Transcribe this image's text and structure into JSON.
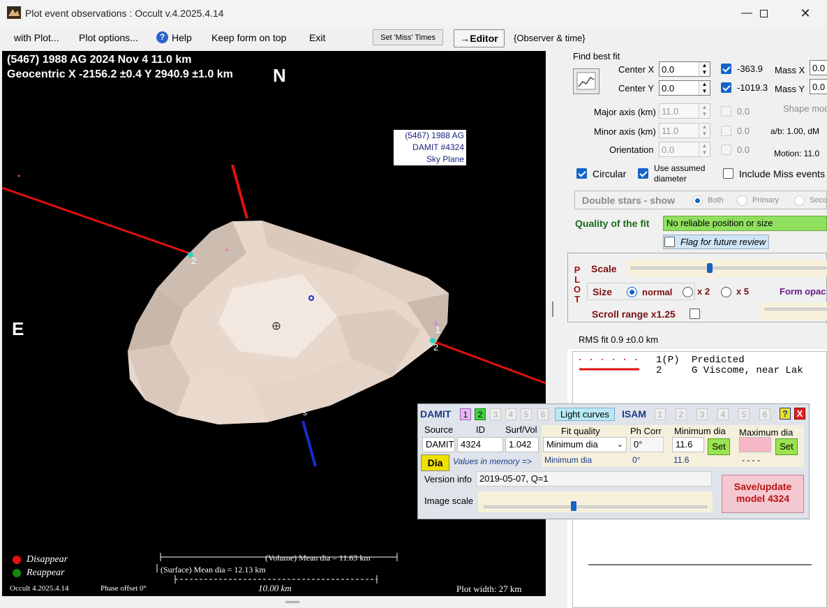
{
  "window": {
    "title": "Plot event observations : Occult v.4.2025.4.14"
  },
  "menu": {
    "with_plot": "with Plot...",
    "plot_options": "Plot options...",
    "help": "Help",
    "keep_on_top": "Keep form on top",
    "exit": "Exit",
    "set_miss_times": "Set 'Miss' Times",
    "editor": "→Editor",
    "observer_time": "{Observer & time}"
  },
  "plot": {
    "header_line1": "(5467) 1988 AG  2024 Nov 4   11.0 km",
    "header_line2": "Geocentric  X  -2156.2 ±0.4  Y 2940.9 ±1.0 km",
    "north": "N",
    "east": "E",
    "info_line1": "(5467) 1988 AG",
    "info_line2": "DAMIT #4324",
    "info_line3": "Sky Plane",
    "chord_label_1": "1",
    "chord_label_2a": "2",
    "chord_label_2b": "2",
    "south_mark": "s",
    "legend_disappear": "Disappear",
    "legend_reappear": "Reappear",
    "volume_mean": "(Volume) Mean dia = 11.63 km",
    "surface_mean": "(Surface) Mean dia = 12.13 km",
    "scale_bar": "10.00 km",
    "version": "Occult 4.2025.4.14",
    "phase_offset": "Phase offset 0°",
    "plot_width": "Plot width: 27 km"
  },
  "fit": {
    "heading": "Find best fit",
    "center_x_label": "Center X",
    "center_x": "0.0",
    "center_y_label": "Center Y",
    "center_y": "0.0",
    "x_val": "-363.9",
    "y_val": "-1019.3",
    "mass_x_label": "Mass X",
    "mass_x": "0.0",
    "mass_y_label": "Mass Y",
    "mass_y": "0.0",
    "major_label": "Major axis (km)",
    "major": "11.0",
    "minor_label": "Minor axis (km)",
    "minor": "11.0",
    "orient_label": "Orientation",
    "orient": "0.0",
    "major_chk": "0.0",
    "minor_chk": "0.0",
    "orient_chk": "0.0",
    "shape_model": "Shape mod",
    "ab": "a/b: 1.00, dM",
    "motion": "Motion: 11.0",
    "circular": "Circular",
    "use_assumed_1": "Use assumed",
    "use_assumed_2": "diameter",
    "include_miss": "Include Miss events",
    "double_stars": "Double stars - show",
    "both": "Both",
    "primary": "Primary",
    "secondary": "Seco",
    "quality_label": "Quality of the fit",
    "quality_value": "No reliable position or size",
    "flag_review": "Flag for future review"
  },
  "plot_ctrl": {
    "side_label": [
      "P",
      "L",
      "O",
      "T"
    ],
    "scale": "Scale",
    "size": "Size",
    "normal": "normal",
    "x2": "x 2",
    "x5": "x 5",
    "form_opacity": "Form opac",
    "scroll_range": "Scroll range x1.25",
    "scale_level": 0.4
  },
  "rms": {
    "label": "RMS fit  0.9 ±0.0 km",
    "row1_id": "1(P)",
    "row1_name": "Predicted",
    "row2_id": "2",
    "row2_name": "G Viscome, near Lak"
  },
  "damit": {
    "title": "DAMIT",
    "nums": [
      "1",
      "2",
      "3",
      "4",
      "5",
      "6"
    ],
    "light_curves": "Light curves",
    "isam": "ISAM",
    "isam_nums": [
      "1",
      "2",
      "3",
      "4",
      "5",
      "6"
    ],
    "help": "?",
    "close": "X",
    "source_label": "Source",
    "id_label": "ID",
    "surfvol_label": "Surf/Vol",
    "source": "DAMIT",
    "id": "4324",
    "surfvol": "1.042",
    "fit_quality_label": "Fit quality",
    "fit_quality": "Minimum dia",
    "ph_corr_label": "Ph Corr",
    "ph_corr": "0°",
    "min_dia_label": "Minimum dia",
    "min_dia": "11.6",
    "max_dia_label": "Maximum dia",
    "set": "Set",
    "dia": "Dia",
    "values_memory": "Values in memory =>",
    "mem_fit": "Minimum dia",
    "mem_ph": "0°",
    "mem_min": "11.6",
    "mem_max": "- - - -",
    "version_label": "Version info",
    "version": "2019-05-07, Q=1",
    "image_scale_label": "Image scale",
    "save_1": "Save/update",
    "save_2": "model 4324",
    "image_scale_level": 0.4
  }
}
